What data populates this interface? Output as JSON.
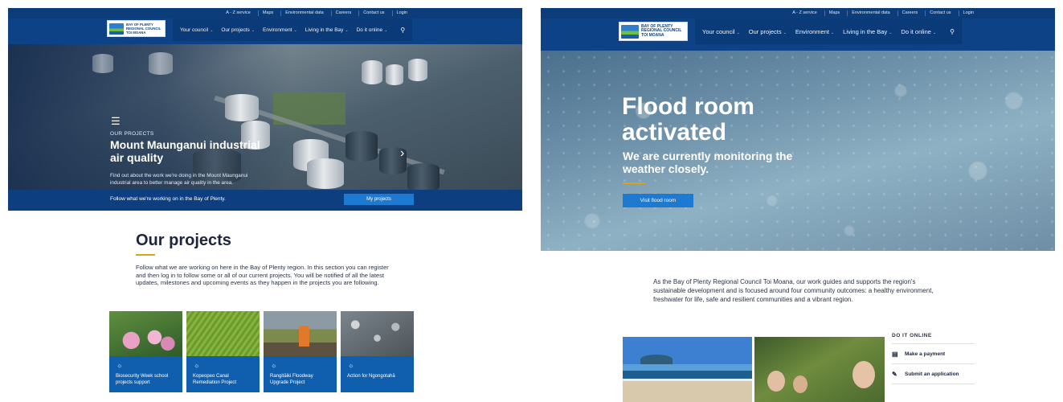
{
  "util_nav": [
    "A - Z service",
    "Maps",
    "Environmental data",
    "Careers",
    "Contact us",
    "Login"
  ],
  "logo": {
    "line1": "BAY OF PLENTY",
    "line2": "REGIONAL COUNCIL",
    "line3": "TOI MOANA"
  },
  "main_nav": [
    "Your council",
    "Our projects",
    "Environment",
    "Living in the Bay",
    "Do it online"
  ],
  "left": {
    "hero": {
      "eyebrow": "OUR PROJECTS",
      "title": "Mount Maunganui industrial air quality",
      "description": "Find out about the work we're doing in the Mount Maunganui industrial area to better manage air quality in the area."
    },
    "follow_bar": {
      "text": "Follow what we're working on in the Bay of Plenty.",
      "button": "My projects"
    },
    "section_title": "Our projects",
    "section_intro": "Follow what we are working on here in the Bay of Plenty region. In this section you can register and then log in to follow some or all of our current projects. You will be notified of all the latest updates, milestones and upcoming events as they happen in the projects you are following.",
    "cards": [
      {
        "label": "Biosecurity Week school projects support"
      },
      {
        "label": "Kopeopeo Canal Remediation Project"
      },
      {
        "label": "Rangitāiki Floodway Upgrade Project"
      },
      {
        "label": "Action for Ngongotahā"
      }
    ]
  },
  "right": {
    "hero": {
      "title": "Flood room activated",
      "subtitle": "We are currently monitoring the weather closely.",
      "button": "Visit flood room"
    },
    "about": "As the Bay of Plenty Regional Council Toi Moana, our work guides and supports the region's sustainable development and is focused around four community outcomes: a healthy environment, freshwater for life, safe and resilient communities and a vibrant region.",
    "do_it_online": {
      "heading": "DO IT ONLINE",
      "items": [
        {
          "label": "Make a payment",
          "icon": "credit-card-icon"
        },
        {
          "label": "Submit an application",
          "icon": "edit-icon"
        }
      ]
    }
  },
  "colors": {
    "brand_blue": "#0d4286",
    "accent_blue": "#1e7ad1",
    "gold": "#d7a21e",
    "card_blue": "#0f5fae"
  }
}
